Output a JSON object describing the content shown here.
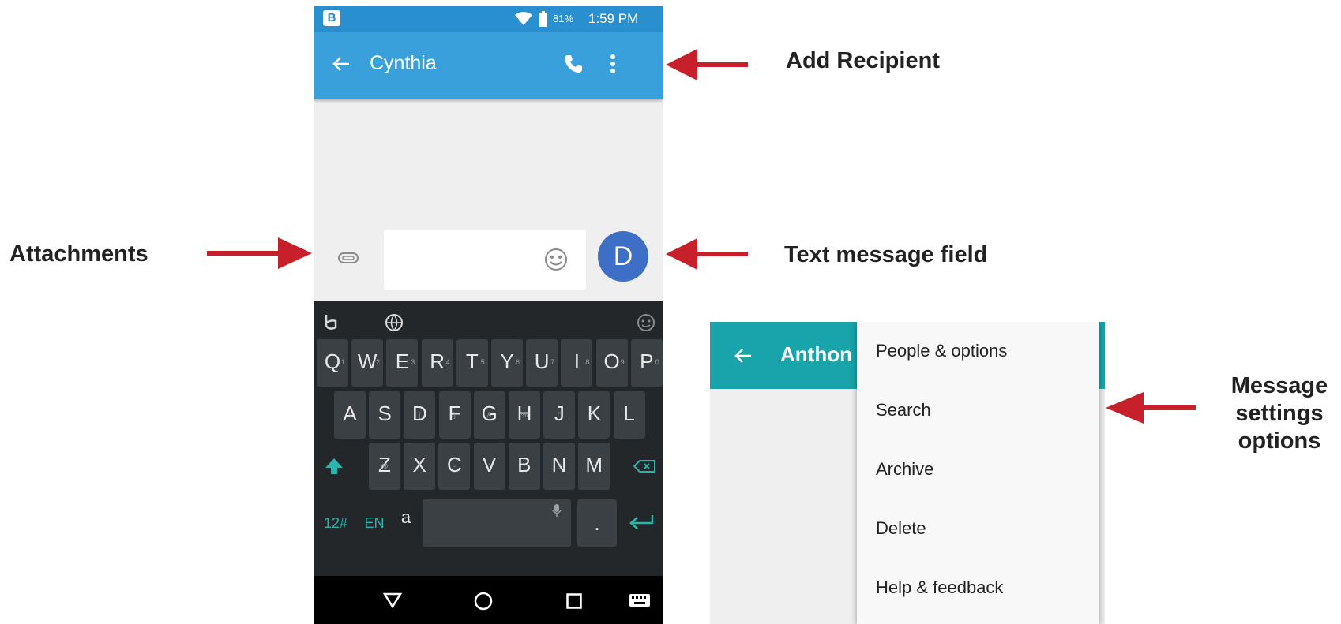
{
  "callouts": {
    "add_recipient": "Add Recipient",
    "attachments": "Attachments",
    "text_message_field": "Text message field",
    "message_settings": [
      "Message",
      "settings",
      "options"
    ]
  },
  "colors": {
    "arrow": "#c8202a",
    "appbar": "#3aa0dc",
    "teal": "#18a4aa",
    "avatar": "#3d6fc6",
    "accent_key": "#2bb3ad"
  },
  "phone": {
    "status": {
      "carrier_badge": "B",
      "battery": "81%",
      "time": "1:59 PM"
    },
    "appbar": {
      "title": "Cynthia",
      "back_icon": "arrow-left-icon",
      "call_icon": "phone-icon",
      "menu_icon": "more-vert-icon"
    },
    "composer": {
      "avatar_letter": "D",
      "attach_icon": "paperclip-icon",
      "emoji_icon": "smiley-icon"
    },
    "keyboard": {
      "row1": [
        {
          "k": "Q",
          "h": "1"
        },
        {
          "k": "W",
          "h": "2"
        },
        {
          "k": "E",
          "h": "3"
        },
        {
          "k": "R",
          "h": "4"
        },
        {
          "k": "T",
          "h": "5"
        },
        {
          "k": "Y",
          "h": "6"
        },
        {
          "k": "U",
          "h": "7"
        },
        {
          "k": "I",
          "h": "8"
        },
        {
          "k": "O",
          "h": "9"
        },
        {
          "k": "P",
          "h": "0"
        }
      ],
      "row2": [
        {
          "k": "A",
          "s": "\\"
        },
        {
          "k": "S",
          "s": "_"
        },
        {
          "k": "D",
          "s": "["
        },
        {
          "k": "F",
          "s": "]"
        },
        {
          "k": "G",
          "s": "&"
        },
        {
          "k": "H",
          "s": "%"
        },
        {
          "k": "J",
          "s": "\""
        },
        {
          "k": "K",
          "s": "*"
        },
        {
          "k": "L",
          "s": ""
        }
      ],
      "row3": [
        {
          "k": "Z",
          "s": "@"
        },
        {
          "k": "X",
          "s": "/"
        },
        {
          "k": "C",
          "s": "-"
        },
        {
          "k": "V",
          "s": "'"
        },
        {
          "k": "B",
          "s": "!"
        },
        {
          "k": "N",
          "s": "?"
        },
        {
          "k": "M",
          "s": ":"
        }
      ],
      "symbols_label": "12#",
      "lang_label": "EN",
      "accent_label": "a",
      "period_label": ".",
      "top_icons": [
        "swype-icon",
        "globe-icon",
        "emoji-icon"
      ]
    },
    "nav": [
      "back-triangle-icon",
      "home-circle-icon",
      "recents-square-icon",
      "keyboard-icon"
    ]
  },
  "menu_shot": {
    "title_partial": "Anthon",
    "items": [
      "People & options",
      "Search",
      "Archive",
      "Delete",
      "Help & feedback"
    ]
  }
}
